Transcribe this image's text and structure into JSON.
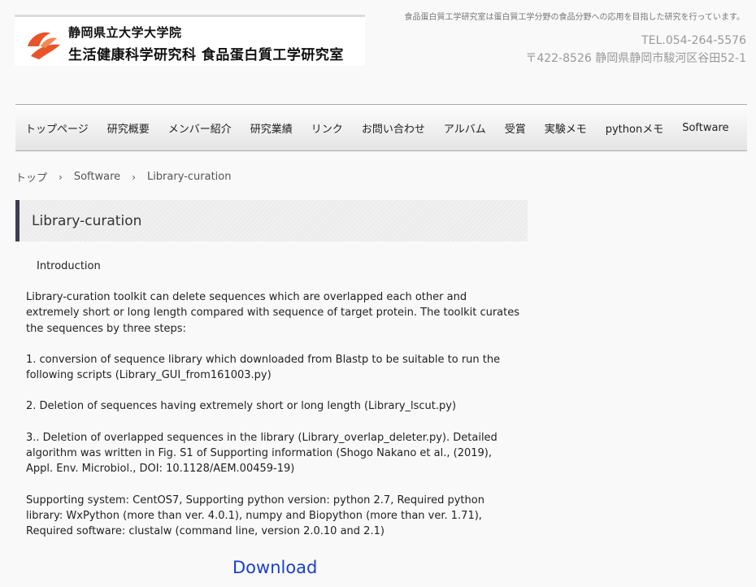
{
  "header": {
    "logo_line1": "静岡県立大学大学院",
    "logo_line2": "生活健康科学研究科 食品蛋白質工学研究室",
    "tagline": "食品蛋白質工学研究室は蛋白質工学分野の食品分野への応用を目指した研究を行っています。",
    "tel": "TEL.054-264-5576",
    "address": "〒422-8526 静岡県静岡市駿河区谷田52-1"
  },
  "nav": {
    "items": [
      {
        "label": "トップページ"
      },
      {
        "label": "研究概要"
      },
      {
        "label": "メンバー紹介"
      },
      {
        "label": "研究業績"
      },
      {
        "label": "リンク"
      },
      {
        "label": "お問い合わせ"
      },
      {
        "label": "アルバム"
      },
      {
        "label": "受賞"
      },
      {
        "label": "実験メモ"
      },
      {
        "label": "pythonメモ"
      },
      {
        "label": "Software"
      }
    ]
  },
  "breadcrumb": {
    "items": [
      "トップ",
      "Software",
      "Library-curation"
    ],
    "separator": "›"
  },
  "page": {
    "title": "Library-curation",
    "intro_heading": "Introduction",
    "paragraphs": [
      "Library-curation toolkit can delete sequences which are overlapped each other and extremely short or long length compared with sequence of target protein. The toolkit curates the sequences by three steps:",
      "1. conversion of sequence library which downloaded from Blastp to be suitable to run the following scripts (Library_GUI_from161003.py)",
      "2. Deletion of sequences having extremely short or long length (Library_lscut.py)",
      "3.. Deletion of overlapped sequences in the library (Library_overlap_deleter.py). Detailed algorithm was written in Fig. S1 of Supporting information (Shogo Nakano et al., (2019), Appl. Env. Microbiol., DOI: 10.1128/AEM.00459-19)",
      "Supporting system: CentOS7, Supporting python version: python 2.7, Required python library: WxPython (more than ver. 4.0.1), numpy and Biopython (more than ver. 1.71), Required software: clustalw (command line, version 2.0.10 and 2.1)"
    ],
    "download_label": "Download"
  },
  "colors": {
    "logo_accent": "#e8552b",
    "title_border": "#3d3d55",
    "link": "#1a3fd0"
  }
}
